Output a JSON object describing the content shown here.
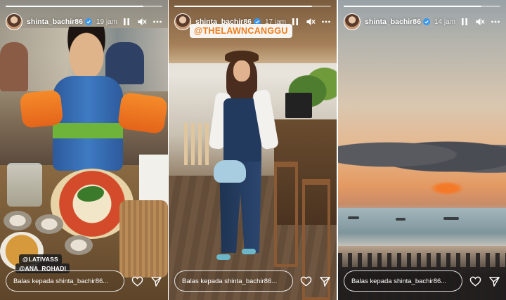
{
  "stories": [
    {
      "username": "shinta_bachir86",
      "time": "19 jam",
      "reply_placeholder": "Balas kepada shinta_bachir86...",
      "progress": 0.88,
      "tags": [
        "@LATIVASS",
        "@ANA_ROHADI"
      ]
    },
    {
      "username": "shinta_bachir86",
      "time": "17 jam",
      "reply_placeholder": "Balas kepada shinta_bachir86...",
      "progress": 0.88,
      "mention": "@THELAWNCANGGU"
    },
    {
      "username": "shinta_bachir86",
      "time": "14 jam",
      "reply_placeholder": "Balas kepada shinta_bachir86...",
      "progress": 0.88
    }
  ],
  "icons": {
    "verified": "verified-badge-icon",
    "pause": "pause-icon",
    "mute": "mute-icon",
    "more": "more-icon",
    "like": "heart-icon",
    "share": "send-icon"
  },
  "colors": {
    "verified": "#3897f0",
    "mention_text": "#ef7d1a",
    "ui_white": "#ffffff"
  }
}
